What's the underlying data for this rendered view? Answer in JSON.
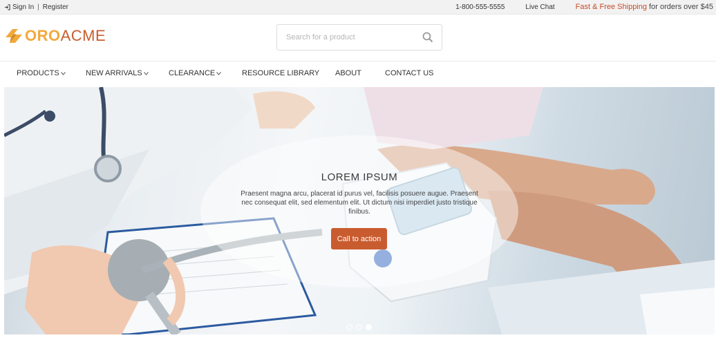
{
  "topbar": {
    "signin_label": "Sign In",
    "separator": "|",
    "register_label": "Register",
    "phone": "1-800-555-5555",
    "live_chat_label": "Live Chat",
    "shipping_highlight": "Fast & Free Shipping",
    "shipping_rest": " for orders over $45",
    "signin_icon": "sign-in-icon"
  },
  "header": {
    "logo_part1": "ORO",
    "logo_part2": "ACME",
    "logo_icon": "oroacme-logo-icon",
    "brand_colors": {
      "oro": "#f2a93b",
      "acme": "#c95c2f"
    },
    "search_placeholder": "Search for a product",
    "search_icon": "search-icon"
  },
  "nav": {
    "items": [
      {
        "label": "PRODUCTS",
        "has_dropdown": true
      },
      {
        "label": "NEW ARRIVALS",
        "has_dropdown": true
      },
      {
        "label": "CLEARANCE",
        "has_dropdown": true
      },
      {
        "label": "RESOURCE LIBRARY",
        "has_dropdown": false
      },
      {
        "label": "ABOUT",
        "has_dropdown": false
      },
      {
        "label": "CONTACT US",
        "has_dropdown": false
      }
    ]
  },
  "hero": {
    "title": "LOREM IPSUM",
    "text": "Praesent magna arcu, placerat id purus vel, facilisis posuere augue. Praesent nec consequat elit, sed elementum elit. Ut dictum nisi imperdiet justo tristique finibus.",
    "cta_label": "Call to action",
    "cta_color": "#c95c2f",
    "slides_count": 3,
    "active_slide": 3
  }
}
